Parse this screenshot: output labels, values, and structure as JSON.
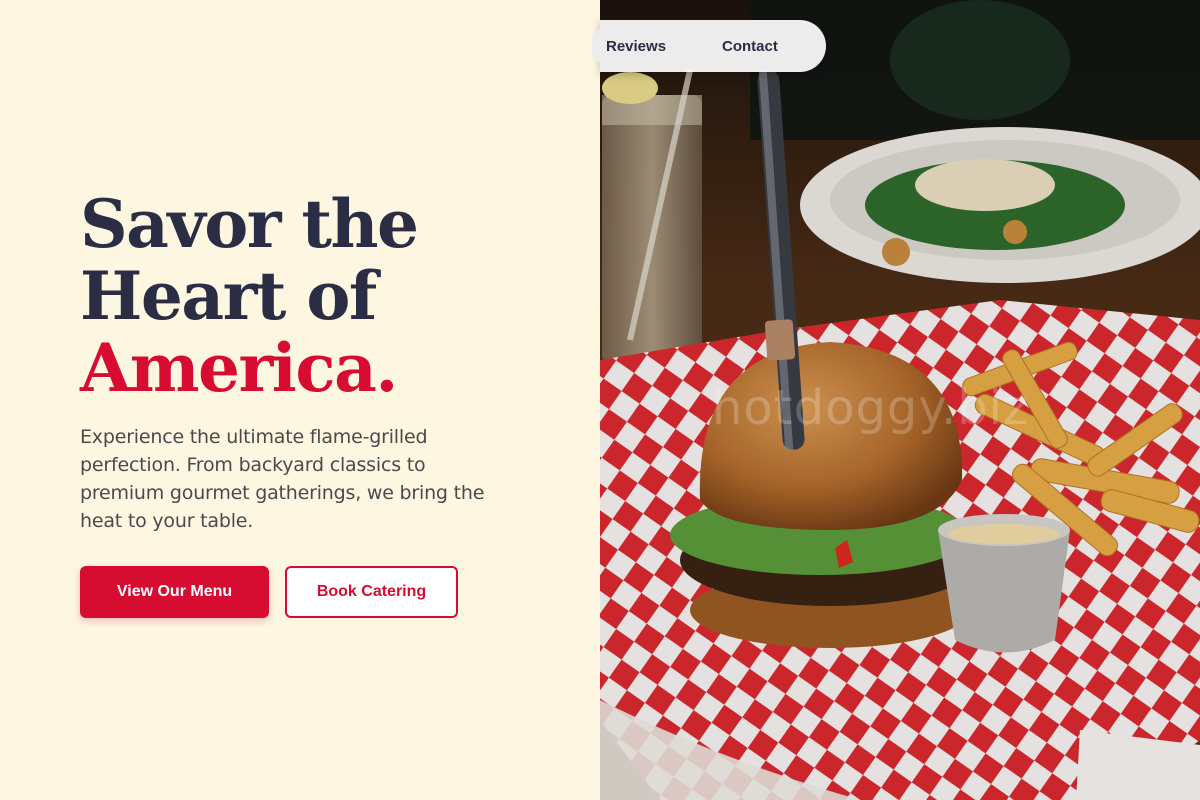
{
  "hero": {
    "headline_line1": "Savor the",
    "headline_line2": "Heart of",
    "headline_line3": "America.",
    "subtext": "Experience the ultimate flame-grilled perfection. From backyard classics to premium gourmet gatherings, we bring the heat to your table.",
    "primary_button": "View Our Menu",
    "secondary_button": "Book Catering"
  },
  "nav": {
    "items": [
      {
        "label": "Reviews"
      },
      {
        "label": "Contact"
      }
    ]
  },
  "photo": {
    "watermark": "hotdoggy.biz"
  },
  "colors": {
    "background": "#fdf7e2",
    "accent": "#d60c31",
    "heading": "#2a2d44",
    "body_text": "#4a4a4a"
  }
}
